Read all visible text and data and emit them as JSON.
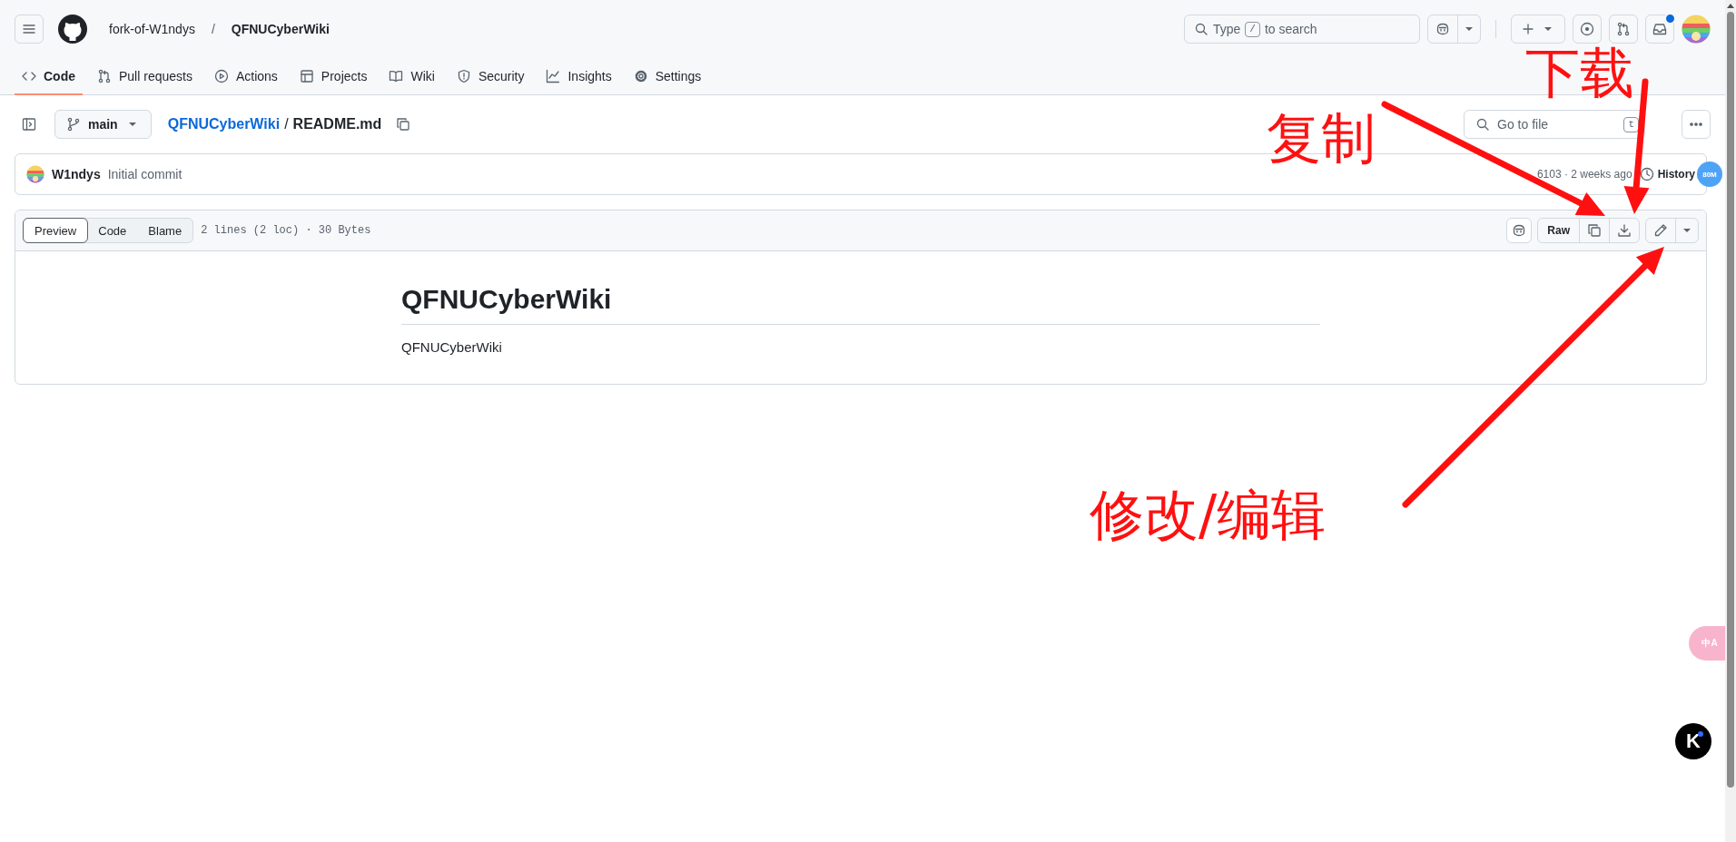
{
  "header": {
    "owner": "fork-of-W1ndys",
    "separator": "/",
    "repo": "QFNUCyberWiki",
    "search": {
      "before": "Type",
      "key": "/",
      "after": "to search"
    },
    "inbox_unread": true
  },
  "nav_tabs": [
    {
      "label": "Code",
      "selected": true
    },
    {
      "label": "Pull requests",
      "selected": false
    },
    {
      "label": "Actions",
      "selected": false
    },
    {
      "label": "Projects",
      "selected": false
    },
    {
      "label": "Wiki",
      "selected": false
    },
    {
      "label": "Security",
      "selected": false
    },
    {
      "label": "Insights",
      "selected": false
    },
    {
      "label": "Settings",
      "selected": false
    }
  ],
  "file_bar": {
    "branch": "main",
    "repo_link": "QFNUCyberWiki",
    "separator": "/",
    "file_name": "README.md",
    "go_to_file": {
      "placeholder": "Go to file",
      "shortcut": "t"
    }
  },
  "commit": {
    "author": "W1ndys",
    "message": "Initial commit",
    "meta": "6103 · 2 weeks ago",
    "history": "History",
    "badge": "80M"
  },
  "viewer": {
    "tabs": [
      {
        "label": "Preview",
        "selected": true
      },
      {
        "label": "Code",
        "selected": false
      },
      {
        "label": "Blame",
        "selected": false
      }
    ],
    "info": "2 lines (2 loc) · 30 Bytes",
    "raw": "Raw"
  },
  "readme": {
    "heading": "QFNUCyberWiki",
    "paragraph": "QFNUCyberWiki"
  },
  "annotations": [
    {
      "text": "下载"
    },
    {
      "text": "复制"
    },
    {
      "text": "修改/编辑"
    }
  ],
  "widgets": {
    "translate": "中A",
    "assistant": "K"
  }
}
